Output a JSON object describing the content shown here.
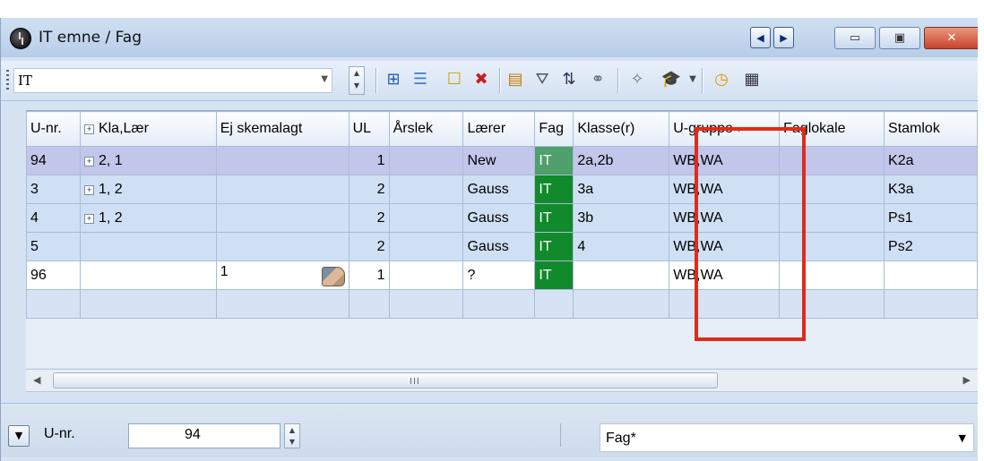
{
  "window": {
    "title": "IT emne / Fag",
    "nav_prev": "◀",
    "nav_next": "▶",
    "minimize": "▭",
    "maximize": "▣",
    "close": "✕"
  },
  "toolbar": {
    "filter_value": "IT",
    "icons": [
      "grid-add-icon",
      "list-icon",
      "new-icon",
      "delete-icon",
      "ruler-icon",
      "filter-icon",
      "sort-icon",
      "link-icon",
      "wand-icon",
      "graduation-cap-icon",
      "clock-icon",
      "calendar-icon"
    ]
  },
  "table": {
    "columns": [
      "U-nr.",
      "Kla,Lær",
      "Ej skemalagt",
      "UL",
      "Årslek",
      "Lærer",
      "Fag",
      "Klasse(r)",
      "U-gruppe",
      "Faglokale",
      "Stamlok"
    ],
    "rows": [
      {
        "unr": "94",
        "klalaer": "2, 1",
        "ej": "",
        "ul": "1",
        "aarslek": "",
        "laerer": "New",
        "fag": "IT",
        "klasse": "2a,2b",
        "ugruppe": "WB,WA",
        "faglokale": "",
        "stamlok": "K2a"
      },
      {
        "unr": "3",
        "klalaer": "1, 2",
        "ej": "",
        "ul": "2",
        "aarslek": "",
        "laerer": "Gauss",
        "fag": "IT",
        "klasse": "3a",
        "ugruppe": "WB,WA",
        "faglokale": "",
        "stamlok": "K3a"
      },
      {
        "unr": "4",
        "klalaer": "1, 2",
        "ej": "",
        "ul": "2",
        "aarslek": "",
        "laerer": "Gauss",
        "fag": "IT",
        "klasse": "3b",
        "ugruppe": "WB,WA",
        "faglokale": "",
        "stamlok": "Ps1"
      },
      {
        "unr": "5",
        "klalaer": "",
        "ej": "",
        "ul": "2",
        "aarslek": "",
        "laerer": "Gauss",
        "fag": "IT",
        "klasse": "4",
        "ugruppe": "WB,WA",
        "faglokale": "",
        "stamlok": "Ps2"
      },
      {
        "unr": "96",
        "klalaer": "",
        "ej": "1",
        "ul": "1",
        "aarslek": "",
        "laerer": "?",
        "fag": "IT",
        "klasse": "",
        "ugruppe": "WB,WA",
        "faglokale": "",
        "stamlok": ""
      }
    ],
    "scroll_grip": "III"
  },
  "statusbar": {
    "field_label": "U-nr.",
    "field_value": "94",
    "view_value": "Fag*"
  }
}
